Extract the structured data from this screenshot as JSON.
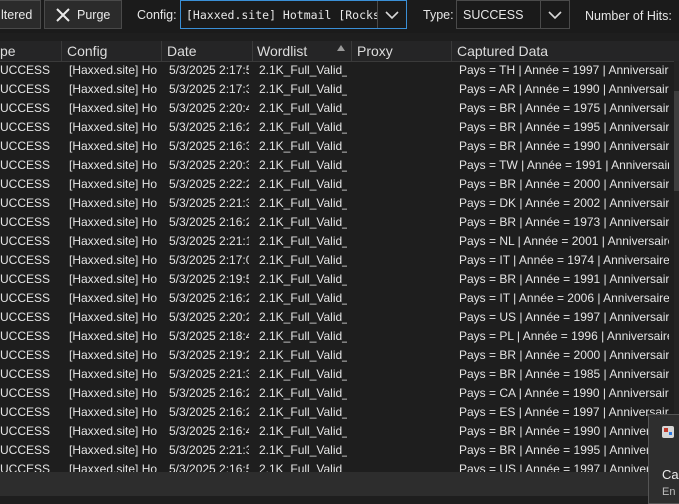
{
  "toolbar": {
    "filtered_label": "ltered",
    "purge_label": "Purge",
    "config_label": "Config:",
    "config_value": "[Haxxed.site] Hotmail [Rocks",
    "type_label": "Type:",
    "type_value": "SUCCESS",
    "hits_label": "Number of Hits:"
  },
  "columns": [
    "pe",
    "Config",
    "Date",
    "Wordlist",
    "Proxy",
    "Captured Data"
  ],
  "rows": [
    [
      "UCCESS",
      "[Haxxed.site] Hot",
      "5/3/2025 2:17:5",
      "2.1K_Full_Valid_H",
      "",
      "Pays = TH | Année = 1997 | Anniversaire"
    ],
    [
      "UCCESS",
      "[Haxxed.site] Hot",
      "5/3/2025 2:17:3",
      "2.1K_Full_Valid_H",
      "",
      "Pays = AR | Année = 1990 | Anniversaire"
    ],
    [
      "UCCESS",
      "[Haxxed.site] Hot",
      "5/3/2025 2:20:4",
      "2.1K_Full_Valid_H",
      "",
      "Pays = BR | Année = 1975 | Anniversaire"
    ],
    [
      "UCCESS",
      "[Haxxed.site] Hot",
      "5/3/2025 2:16:2",
      "2.1K_Full_Valid_H",
      "",
      "Pays = BR | Année = 1995 | Anniversaire"
    ],
    [
      "UCCESS",
      "[Haxxed.site] Hot",
      "5/3/2025 2:16:3",
      "2.1K_Full_Valid_H",
      "",
      "Pays = BR | Année = 1990 | Anniversaire"
    ],
    [
      "UCCESS",
      "[Haxxed.site] Hot",
      "5/3/2025 2:20:3",
      "2.1K_Full_Valid_H",
      "",
      "Pays = TW | Année = 1991 | Anniversaire"
    ],
    [
      "UCCESS",
      "[Haxxed.site] Hot",
      "5/3/2025 2:22:2",
      "2.1K_Full_Valid_H",
      "",
      "Pays = BR | Année = 2000 | Anniversaire"
    ],
    [
      "UCCESS",
      "[Haxxed.site] Hot",
      "5/3/2025 2:21:3",
      "2.1K_Full_Valid_H",
      "",
      "Pays = DK | Année = 2002 | Anniversaire"
    ],
    [
      "UCCESS",
      "[Haxxed.site] Hot",
      "5/3/2025 2:16:2",
      "2.1K_Full_Valid_H",
      "",
      "Pays = BR | Année = 1973 | Anniversaire"
    ],
    [
      "UCCESS",
      "[Haxxed.site] Hot",
      "5/3/2025 2:21:1",
      "2.1K_Full_Valid_H",
      "",
      "Pays = NL | Année = 2001 | Anniversaire"
    ],
    [
      "UCCESS",
      "[Haxxed.site] Hot",
      "5/3/2025 2:17:0",
      "2.1K_Full_Valid_H",
      "",
      "Pays = IT | Année = 1974 | Anniversaire"
    ],
    [
      "UCCESS",
      "[Haxxed.site] Hot",
      "5/3/2025 2:19:5",
      "2.1K_Full_Valid_H",
      "",
      "Pays = BR | Année = 1991 | Anniversaire"
    ],
    [
      "UCCESS",
      "[Haxxed.site] Hot",
      "5/3/2025 2:16:2",
      "2.1K_Full_Valid_H",
      "",
      "Pays = IT | Année = 2006 | Anniversaire"
    ],
    [
      "UCCESS",
      "[Haxxed.site] Hot",
      "5/3/2025 2:20:2",
      "2.1K_Full_Valid_H",
      "",
      "Pays = US | Année = 1997 | Anniversaire"
    ],
    [
      "UCCESS",
      "[Haxxed.site] Hot",
      "5/3/2025 2:18:4",
      "2.1K_Full_Valid_H",
      "",
      "Pays = PL | Année = 1996 | Anniversaire"
    ],
    [
      "UCCESS",
      "[Haxxed.site] Hot",
      "5/3/2025 2:19:2",
      "2.1K_Full_Valid_H",
      "",
      "Pays = BR | Année = 2000 | Anniversaire"
    ],
    [
      "UCCESS",
      "[Haxxed.site] Hot",
      "5/3/2025 2:21:3",
      "2.1K_Full_Valid_H",
      "",
      "Pays = BR | Année = 1985 | Anniversaire"
    ],
    [
      "UCCESS",
      "[Haxxed.site] Hot",
      "5/3/2025 2:16:2",
      "2.1K_Full_Valid_H",
      "",
      "Pays = CA | Année = 1990 | Anniversaire"
    ],
    [
      "UCCESS",
      "[Haxxed.site] Hot",
      "5/3/2025 2:16:2",
      "2.1K_Full_Valid_H",
      "",
      "Pays = ES | Année = 1997 | Anniversaire"
    ],
    [
      "UCCESS",
      "[Haxxed.site] Hot",
      "5/3/2025 2:16:4",
      "2.1K_Full_Valid_H",
      "",
      "Pays = BR | Année = 1990 | Anniversaire"
    ],
    [
      "UCCESS",
      "[Haxxed.site] Hot",
      "5/3/2025 2:21:3",
      "2.1K_Full_Valid_H",
      "",
      "Pays = BR | Année = 1995 | Anniversaire"
    ],
    [
      "UCCESS",
      "[Haxxed.site] Hot",
      "5/3/2025 2:16:5",
      "2.1K_Full_Valid_H",
      "",
      "Pays = US | Année = 1997 | Anniversaire"
    ]
  ],
  "popup": {
    "line1": "Ca",
    "line2": "En"
  }
}
